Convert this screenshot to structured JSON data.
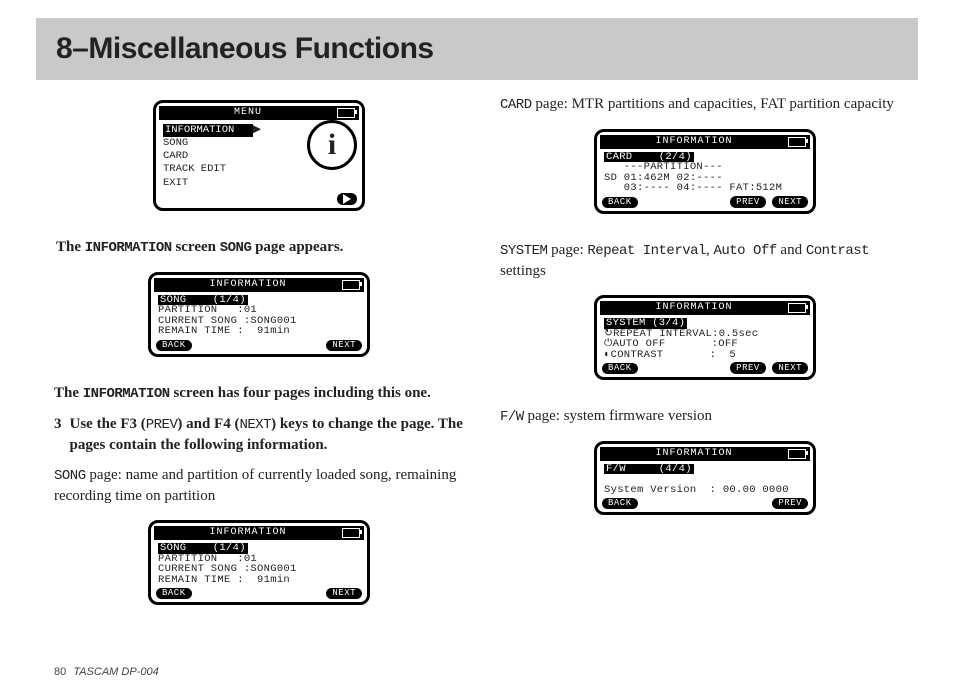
{
  "header": {
    "title": "8–Miscellaneous Functions"
  },
  "footer": {
    "page": "80",
    "product": "TASCAM  DP-004"
  },
  "left": {
    "menuScreen": {
      "title": "MENU",
      "items": [
        "INFORMATION",
        "SONG",
        "CARD",
        "TRACK EDIT",
        "EXIT"
      ],
      "infoGlyph": "i"
    },
    "p1a": "The ",
    "p1b": "INFORMATION",
    "p1c": " screen ",
    "p1d": "SONG",
    "p1e": " page appears.",
    "songScreen1": {
      "title": "INFORMATION",
      "header": "SONG    (1/4)",
      "lines": [
        "PARTITION   :01",
        "CURRENT SONG :SONG001",
        "REMAIN TIME :  91min"
      ],
      "back": "BACK",
      "next": "NEXT"
    },
    "p2a": "The ",
    "p2b": "INFORMATION",
    "p2c": " screen has four pages including this one.",
    "step3": {
      "num": "3",
      "a": "Use the ",
      "b": "F3",
      "c": " (",
      "d": "PREV",
      "e": ") and ",
      "f": "F4",
      "g": " (",
      "h": "NEXT",
      "i": ") keys to change the page. The pages contain the following information."
    },
    "p3a": "SONG",
    "p3b": " page: name and partition of currently loaded song, remaining recording time on partition",
    "songScreen2": {
      "title": "INFORMATION",
      "header": "SONG    (1/4)",
      "lines": [
        "PARTITION   :01",
        "CURRENT SONG :SONG001",
        "REMAIN TIME :  91min"
      ],
      "back": "BACK",
      "next": "NEXT"
    }
  },
  "right": {
    "p_card_a": "CARD",
    "p_card_b": " page: MTR partitions and capacities, FAT partition capacity",
    "cardScreen": {
      "title": "INFORMATION",
      "header": "CARD    (2/4)",
      "lines": [
        "   ---PARTITION---",
        "SD 01:462M 02:----",
        "   03:---- 04:---- FAT:512M"
      ],
      "back": "BACK",
      "prev": "PREV",
      "next": "NEXT"
    },
    "p_sys_a": "SYSTEM",
    "p_sys_b": " page: ",
    "p_sys_c": "Repeat Interval",
    "p_sys_d": ", ",
    "p_sys_e": "Auto Off",
    "p_sys_f": " and ",
    "p_sys_g": "Contrast",
    "p_sys_h": "settings",
    "sysScreen": {
      "title": "INFORMATION",
      "header": "SYSTEM (3/4)",
      "lines": [
        "↻REPEAT INTERVAL:0.5sec",
        "⏻AUTO OFF       :OFF",
        "◐CONTRAST       :  5"
      ],
      "back": "BACK",
      "prev": "PREV",
      "next": "NEXT"
    },
    "p_fw_a": "F/W",
    "p_fw_b": " page: system firmware version",
    "fwScreen": {
      "title": "INFORMATION",
      "header": "F/W     (4/4)",
      "line": "System Version  : 00.00 0000",
      "back": "BACK",
      "prev": "PREV"
    }
  }
}
